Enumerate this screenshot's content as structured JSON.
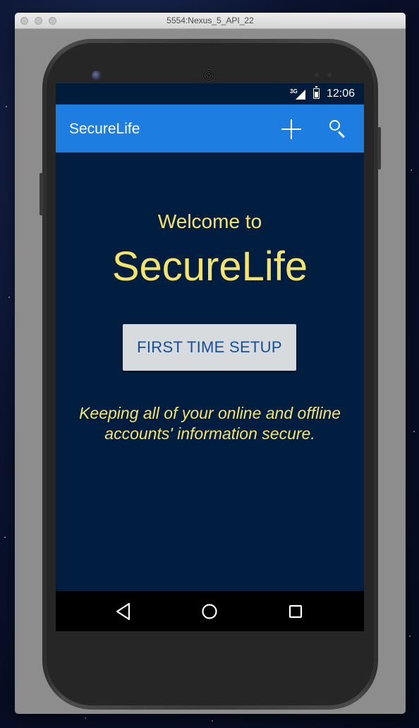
{
  "window": {
    "title": "5554:Nexus_5_API_22"
  },
  "status_bar": {
    "network": "3G",
    "time": "12:06"
  },
  "app_bar": {
    "title": "SecureLife",
    "icons": {
      "add": "plus-icon",
      "search": "search-icon"
    }
  },
  "main": {
    "welcome": "Welcome to",
    "app_name": "SecureLife",
    "setup_button": "FIRST TIME SETUP",
    "tagline_line1": "Keeping all of your online and offline",
    "tagline_line2": "accounts' information secure."
  },
  "nav_bar": {
    "icons": {
      "back": "back-triangle-icon",
      "home": "home-circle-icon",
      "recents": "recents-square-icon"
    }
  },
  "colors": {
    "screen_bg": "#011e40",
    "app_bar": "#1e7de0",
    "accent_text": "#f7e36b",
    "button_bg": "#d8dbde",
    "button_text": "#154f97"
  }
}
